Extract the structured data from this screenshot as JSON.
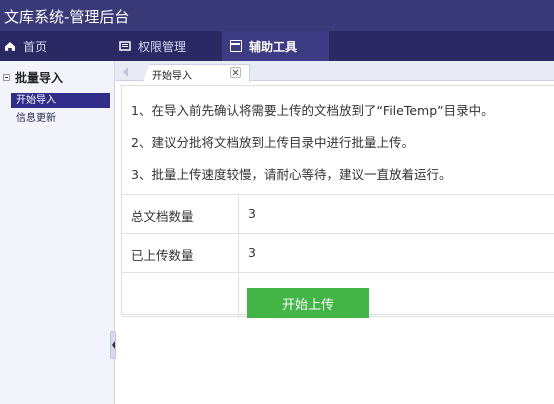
{
  "app": {
    "title": "文库系统-管理后台"
  },
  "nav": {
    "items": [
      {
        "label": "首页",
        "icon": "home-icon"
      },
      {
        "label": "权限管理",
        "icon": "permission-icon"
      },
      {
        "label": "辅助工具",
        "icon": "tools-icon"
      }
    ]
  },
  "sidebar": {
    "section_title": "批量导入",
    "items": [
      {
        "label": "开始导入"
      },
      {
        "label": "信息更新"
      }
    ]
  },
  "tab": {
    "label": "开始导入"
  },
  "notes": [
    "1、在导入前先确认将需要上传的文档放到了“FileTemp”目录中。",
    "2、建议分批将文档放到上传目录中进行批量上传。",
    "3、批量上传速度较慢，请耐心等待，建议一直放着运行。"
  ],
  "stats": [
    {
      "label": "总文档数量",
      "value": "3"
    },
    {
      "label": "已上传数量",
      "value": "3"
    }
  ],
  "actions": {
    "start_label": "开始上传"
  },
  "colors": {
    "accent": "#43b547",
    "header_bg": "#3b3a78",
    "nav_bg": "#2b2963",
    "active_bg": "#2f2c8a"
  }
}
